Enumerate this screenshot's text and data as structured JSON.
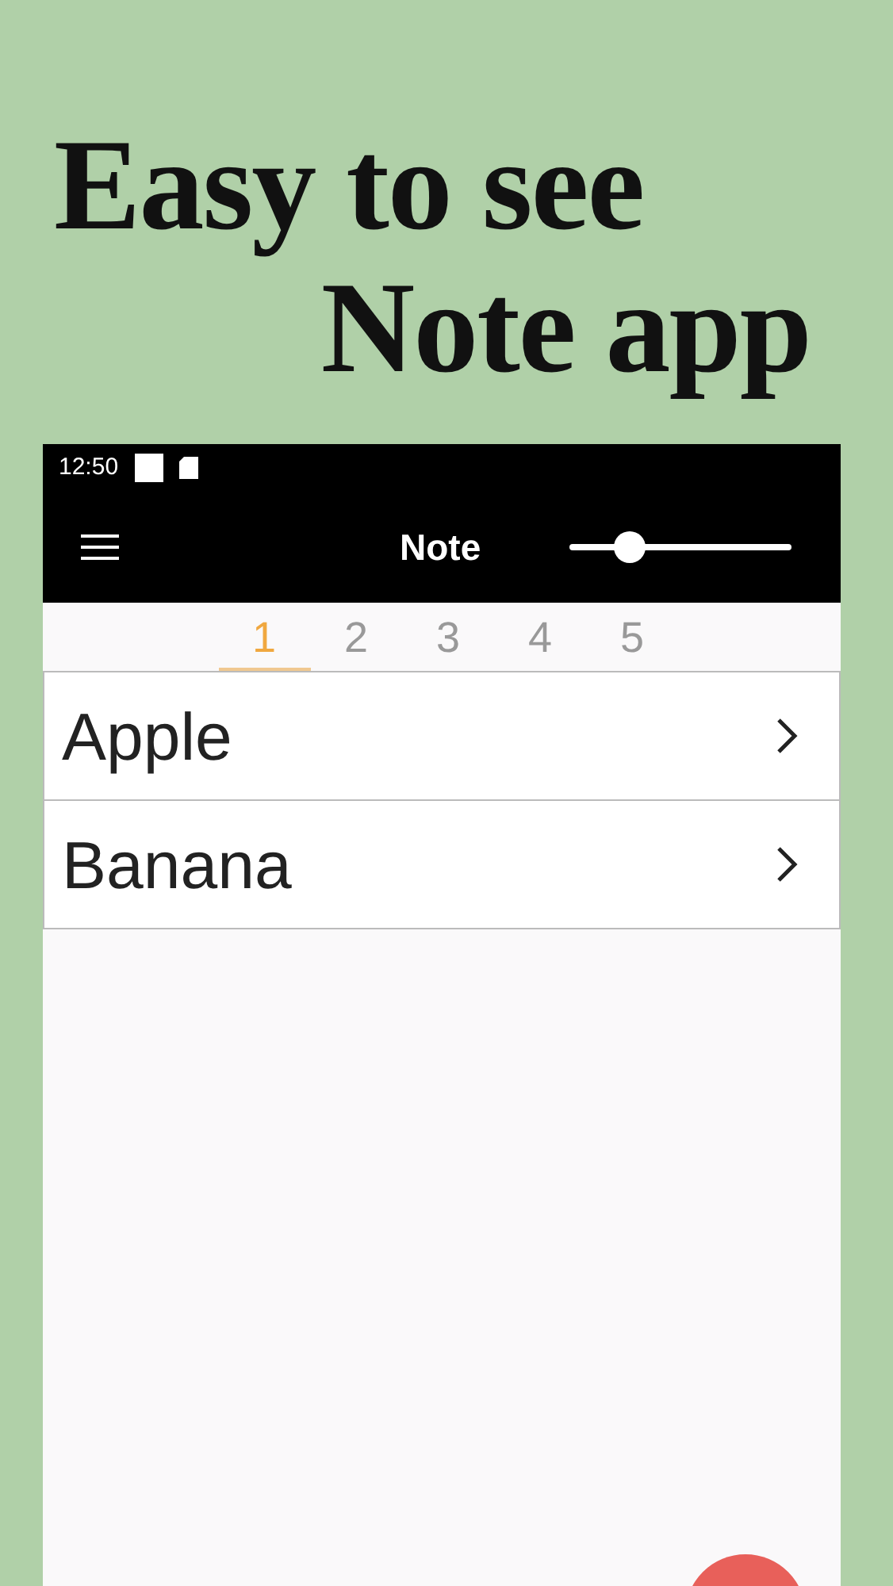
{
  "headline": [
    "Easy to see",
    "Note app"
  ],
  "status_bar": {
    "time": "12:50"
  },
  "toolbar": {
    "title": "Note",
    "slider": {
      "level": 0.27
    }
  },
  "tabs": [
    {
      "label": "1",
      "selected": true
    },
    {
      "label": "2",
      "selected": false
    },
    {
      "label": "3",
      "selected": false
    },
    {
      "label": "4",
      "selected": false
    },
    {
      "label": "5",
      "selected": false
    }
  ],
  "notes": [
    {
      "title": "Apple"
    },
    {
      "title": "Banana"
    }
  ]
}
